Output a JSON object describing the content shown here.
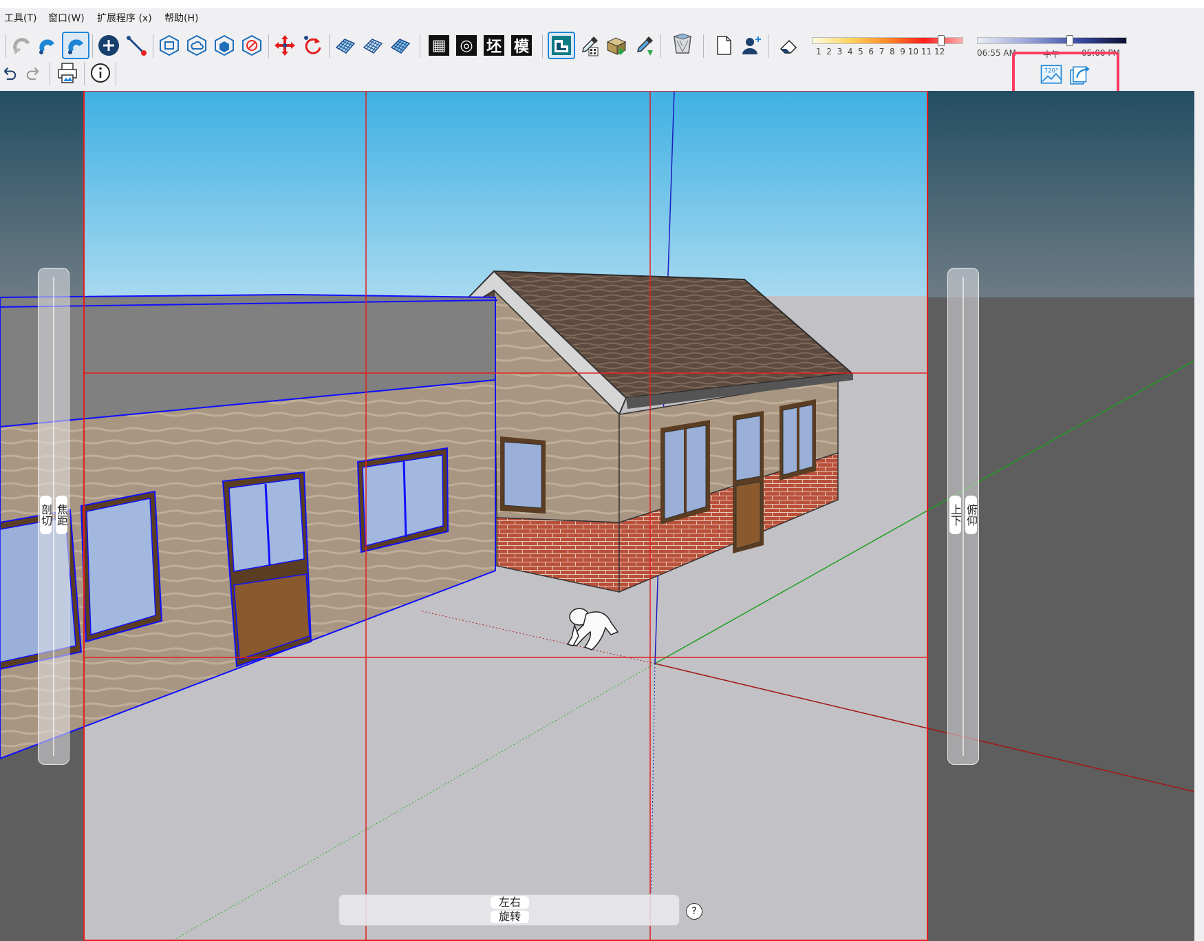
{
  "menu": {
    "items": [
      "工具(T)",
      "窗口(W)",
      "扩展程序 (x)",
      "帮助(H)"
    ]
  },
  "toolbar": {
    "icons": [
      "eraser-magnet-icon",
      "magnet-icon",
      "magnet-active-icon",
      "add-circle-icon",
      "line-tool-icon",
      "box-outline-icon",
      "cloud-box-icon",
      "cube-icon",
      "no-box-icon",
      "move-icon",
      "rotate-icon",
      "mesh-icon",
      "mesh-2-icon",
      "mesh-3-icon"
    ],
    "square_buttons": [
      "▦",
      "◎",
      "坯",
      "模"
    ],
    "style_icons": [
      "style-builder-icon",
      "dropper-paint-icon",
      "texture-icon",
      "dropper-icon",
      "bucket-icon"
    ],
    "page_icons": [
      "new-page-icon",
      "add-user-icon"
    ]
  },
  "shadow": {
    "scale_numbers": [
      "1",
      "2",
      "3",
      "4",
      "5",
      "6",
      "7",
      "8",
      "9",
      "10",
      "11",
      "12"
    ],
    "month_level": 0.86,
    "time_start": "06:55 AM",
    "time_mid": "中午",
    "time_end": "05:00 PM",
    "time_level": 0.62
  },
  "toolbar2": {
    "icons": [
      "undo-icon",
      "redo-icon",
      "print-icon",
      "info-icon"
    ]
  },
  "export": {
    "icons": [
      "panorama-720-icon",
      "export-share-icon"
    ],
    "pano_text": "720°"
  },
  "viewport": {
    "left_slider": {
      "labels": [
        "剖切",
        "焦距"
      ]
    },
    "right_slider": {
      "labels": [
        "上下",
        "俯仰"
      ]
    },
    "bottom_slider": {
      "labels": [
        "左右",
        "旋转"
      ]
    },
    "help": "?"
  },
  "colors": {
    "accent_red": "#ff3b5f",
    "sky_top": "#3eb0e3",
    "sky_bottom": "#a7d9f0",
    "ground": "#c2c2c6",
    "selection_blue": "#1010ff"
  }
}
